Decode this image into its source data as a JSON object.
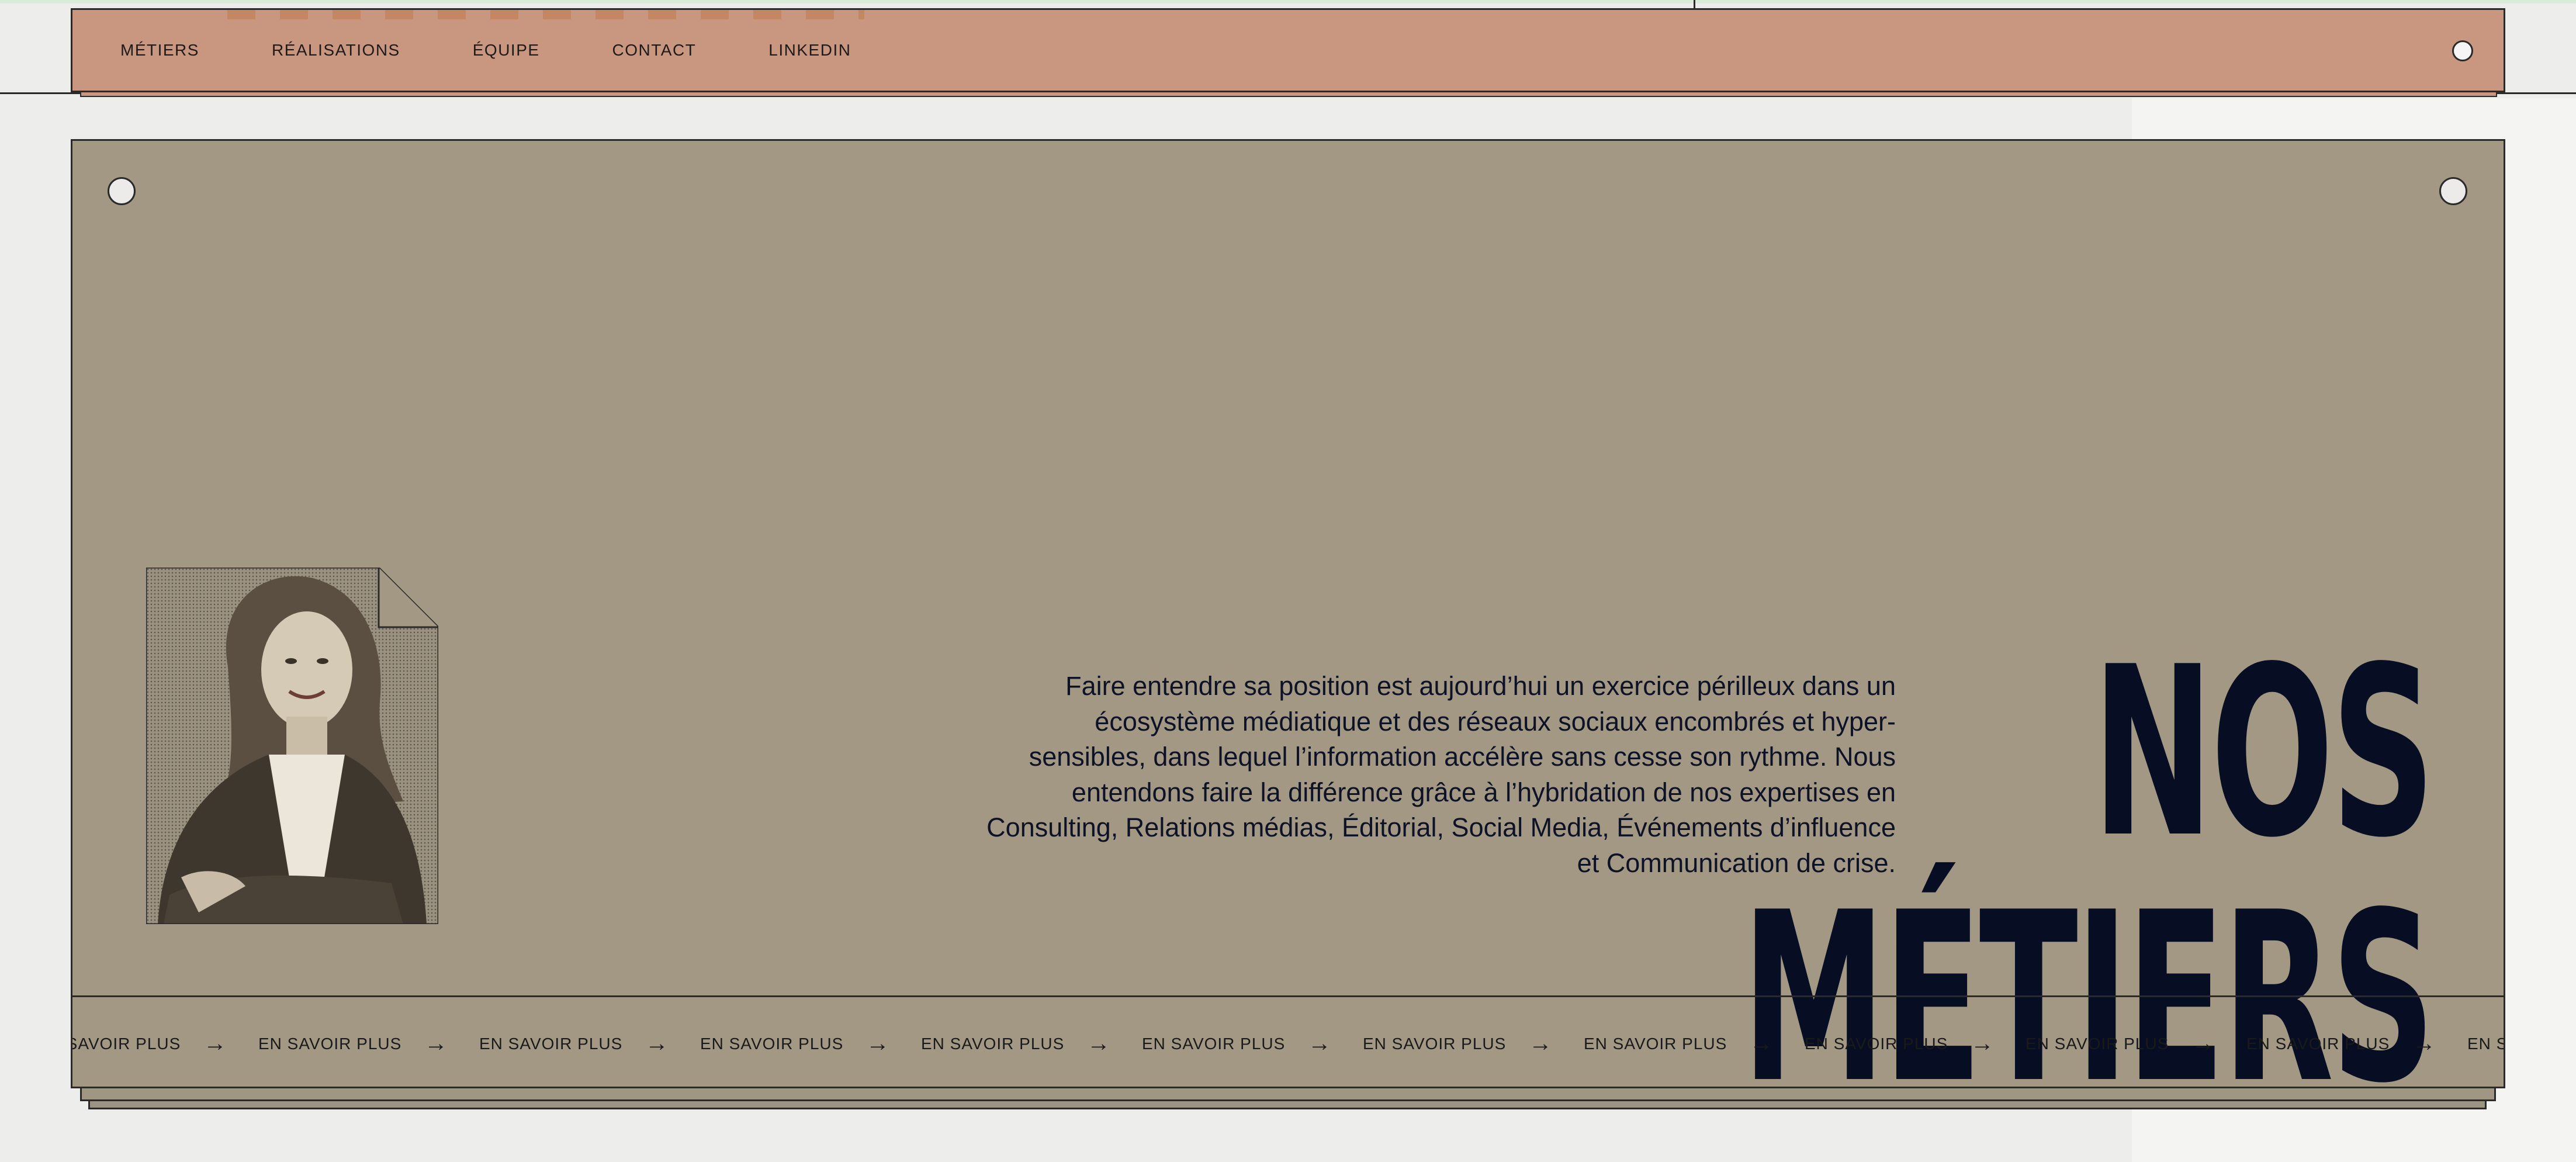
{
  "nav": {
    "items": [
      {
        "label": "MÉTIERS"
      },
      {
        "label": "RÉALISATIONS"
      },
      {
        "label": "ÉQUIPE"
      },
      {
        "label": "CONTACT"
      },
      {
        "label": "LINKEDIN"
      }
    ]
  },
  "hero": {
    "title_line1": "NOS",
    "title_line2": "MÉTIERS",
    "description": "Faire entendre sa position est aujourd’hui un exercice périlleux dans un écosystème médiatique et des réseaux sociaux encombrés et hyper-sensibles, dans lequel l’information accélère sans cesse son rythme. Nous entendons faire la différence grâce à l’hybridation de nos expertises en Consulting, Relations médias, Éditorial, Social Media, Événements d’influence et Communication de crise."
  },
  "marquee": {
    "items": [
      {
        "label": "EN SAVOIR PLUS",
        "arrow": "→"
      },
      {
        "label": "EN SAVOIR PLUS",
        "arrow": "→"
      },
      {
        "label": "EN SAVOIR PLUS",
        "arrow": "→"
      },
      {
        "label": "EN SAVOIR PLUS",
        "arrow": "→"
      },
      {
        "label": "EN SAVOIR PLUS",
        "arrow": "→"
      },
      {
        "label": "EN SAVOIR PLUS",
        "arrow": "→"
      },
      {
        "label": "EN SAVOIR PLUS",
        "arrow": "→"
      },
      {
        "label": "EN SAVOIR PLUS",
        "arrow": "→"
      },
      {
        "label": "EN SAVOIR PLUS",
        "arrow": "→"
      },
      {
        "label": "EN SAVOIR PLUS",
        "arrow": "→"
      },
      {
        "label": "EN SAVOIR PLUS",
        "arrow": "→"
      },
      {
        "label": "EN SAVOIR PLUS",
        "arrow": "→"
      }
    ]
  },
  "colors": {
    "nav_bg": "#c9967f",
    "card_bg": "#a29884",
    "title": "#070d22",
    "page_bg": "#ededec"
  },
  "icons": [
    "menu-dot-icon",
    "pin-icon",
    "arrow-right-icon"
  ]
}
